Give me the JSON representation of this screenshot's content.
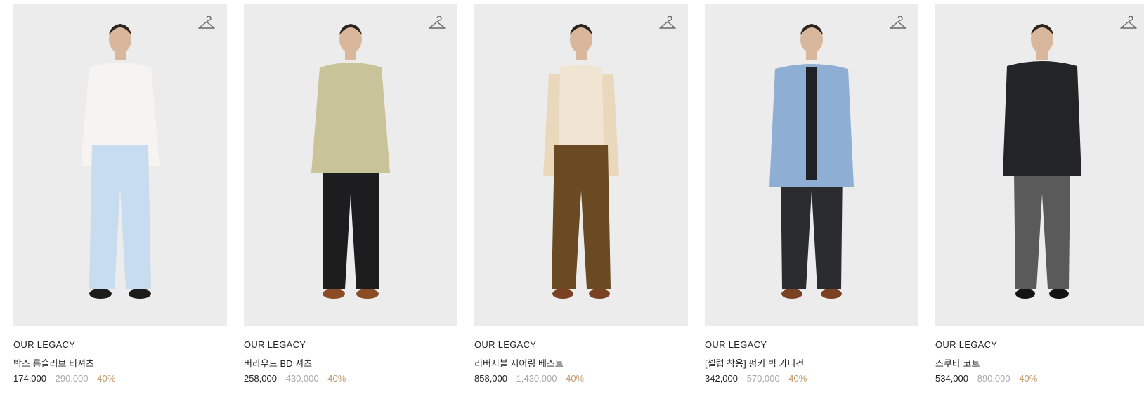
{
  "products": [
    {
      "brand": "OUR LEGACY",
      "name": "박스 롱슬리브 티셔츠",
      "price": "174,000",
      "original_price": "290,000",
      "discount": "40%",
      "icon": "hanger-icon",
      "colors": {
        "top": "#f6f3f0",
        "bottom": "#c7dcee",
        "shoes": "#1c1c1c"
      }
    },
    {
      "brand": "OUR LEGACY",
      "name": "버라우드 BD 셔츠",
      "price": "258,000",
      "original_price": "430,000",
      "discount": "40%",
      "icon": "hanger-icon",
      "colors": {
        "top": "#c9c39a",
        "bottom": "#1d1d1f",
        "shoes": "#8a4b25"
      }
    },
    {
      "brand": "OUR LEGACY",
      "name": "리버시블 시어링 베스트",
      "price": "858,000",
      "original_price": "1,430,000",
      "discount": "40%",
      "icon": "hanger-icon",
      "colors": {
        "top": "#efe5d2",
        "bottom": "#6a4a22",
        "shoes": "#7a4222"
      }
    },
    {
      "brand": "OUR LEGACY",
      "name": "[셀럽 착용] 펑키 빅 가디건",
      "price": "342,000",
      "original_price": "570,000",
      "discount": "40%",
      "icon": "hanger-icon",
      "colors": {
        "top": "#8eaed3",
        "bottom": "#2a2c30",
        "shoes": "#7a4222"
      }
    },
    {
      "brand": "OUR LEGACY",
      "name": "스쿠타 코트",
      "price": "534,000",
      "original_price": "890,000",
      "discount": "40%",
      "icon": "hanger-icon",
      "colors": {
        "top": "#222428",
        "bottom": "#5a5a5a",
        "shoes": "#121212"
      }
    }
  ],
  "palette": {
    "image_bg": "#ececec",
    "text": "#222222",
    "original_price": "#a9a9a9",
    "discount": "#c49a6c"
  }
}
